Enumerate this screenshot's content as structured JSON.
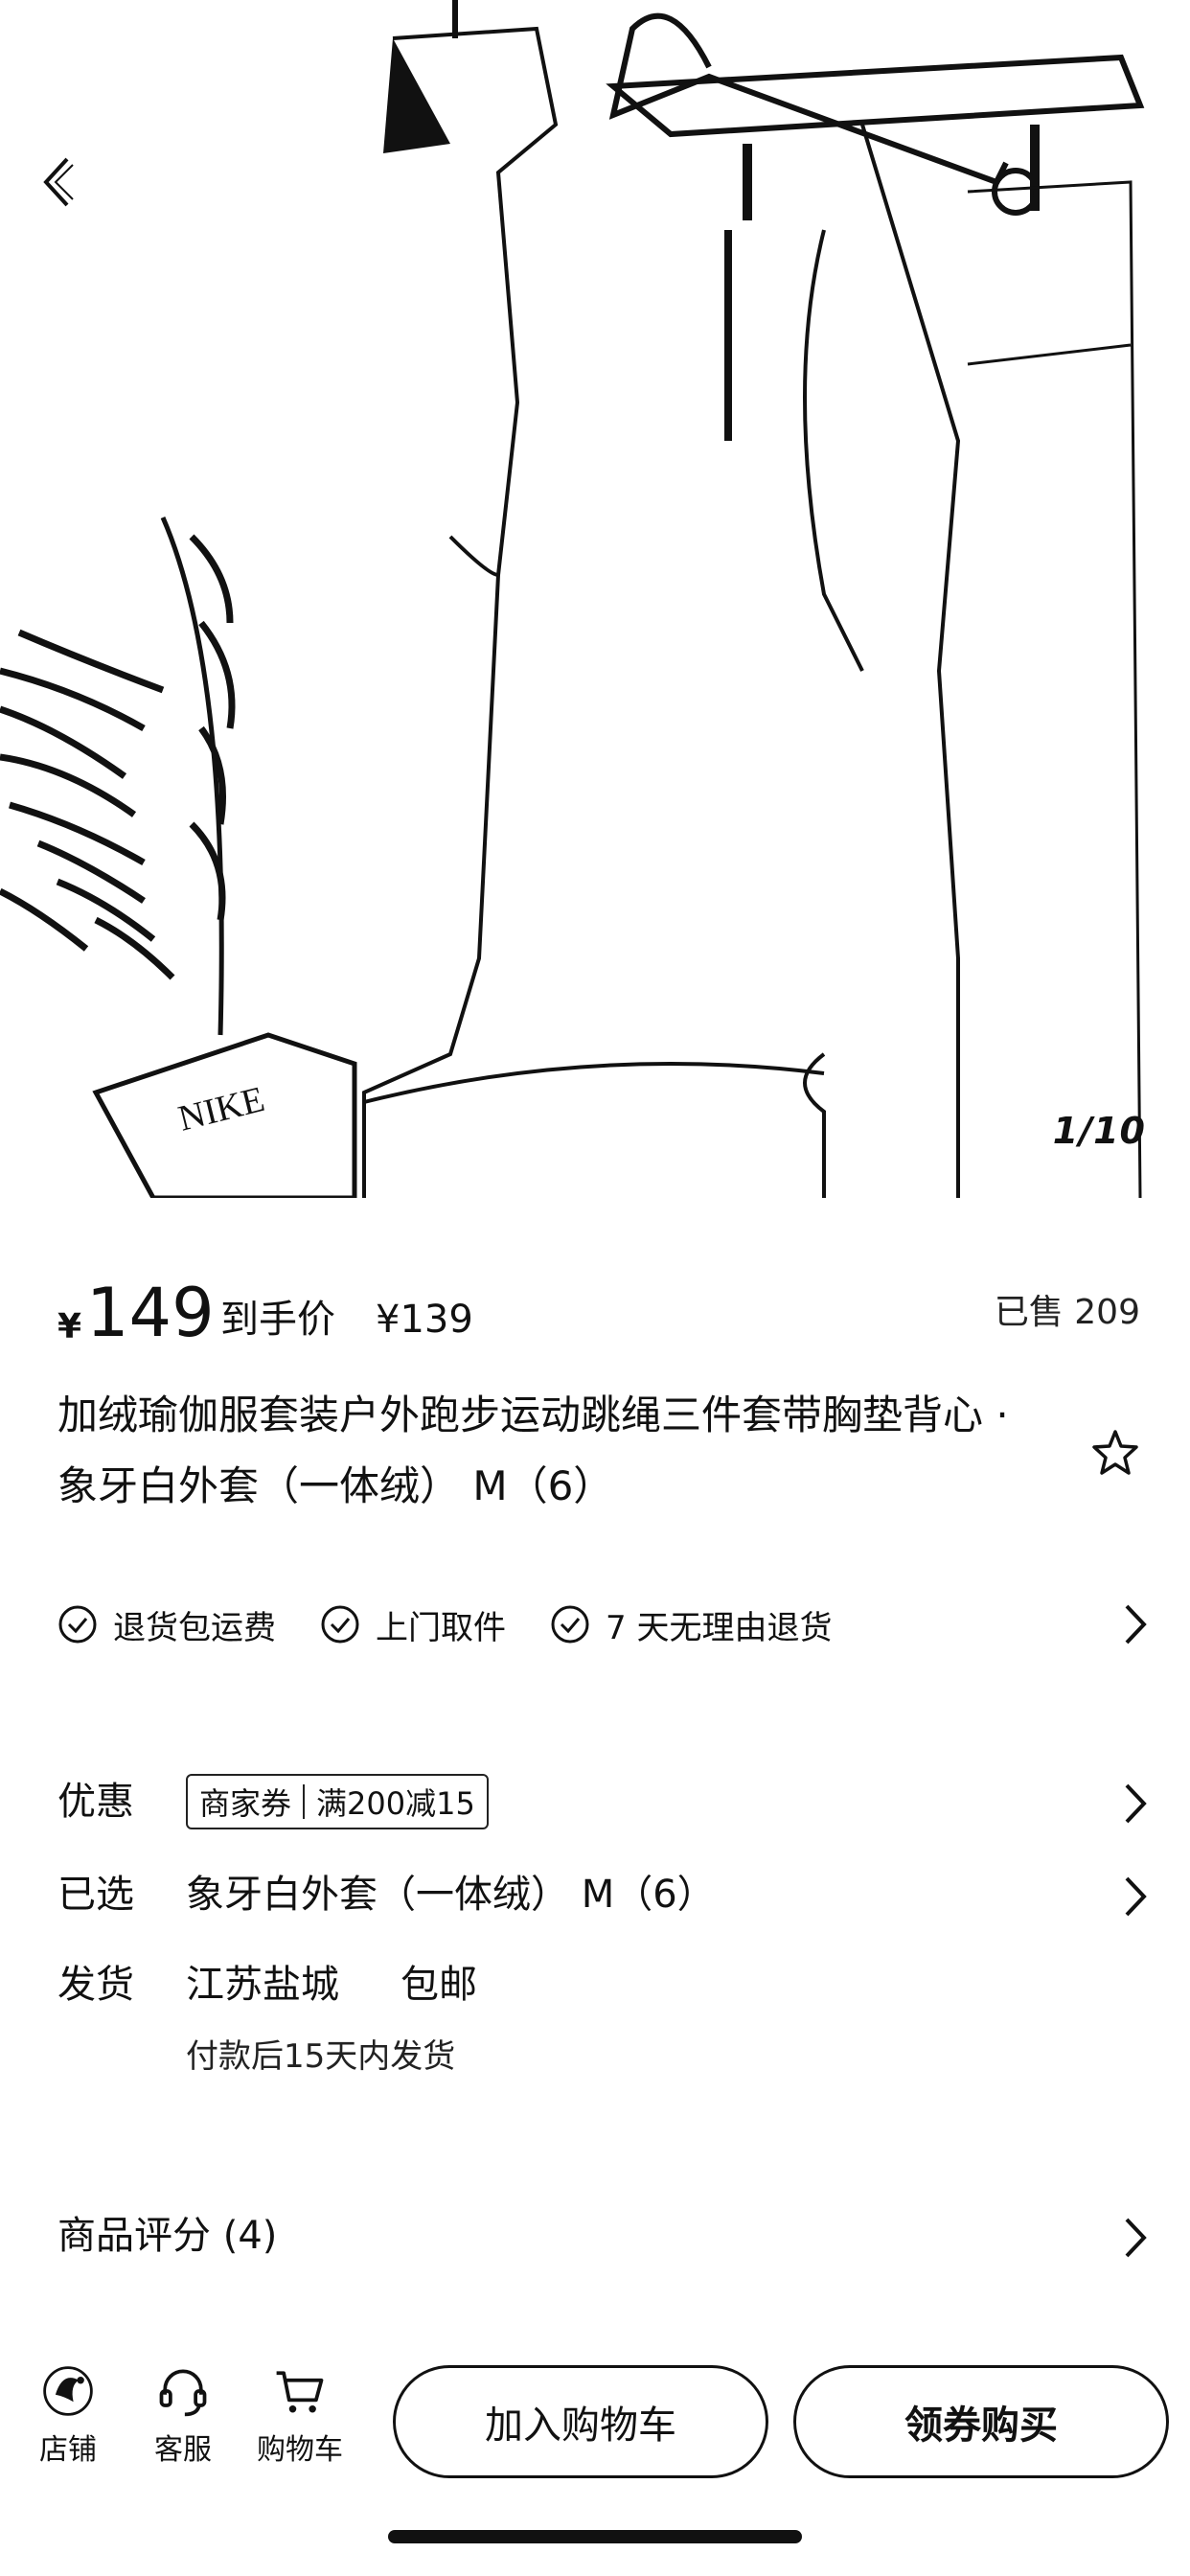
{
  "gallery": {
    "counter": "1/10",
    "logo_text": "NIKE"
  },
  "price": {
    "currency": "¥",
    "amount": "149",
    "net_label": "到手价",
    "net_price": "¥139",
    "sold": "已售 209"
  },
  "product": {
    "title": "加绒瑜伽服套装户外跑步运动跳绳三件套带胸垫背心 · 象牙白外套（一体绒） M（6）"
  },
  "services": [
    "退货包运费",
    "上门取件",
    "7 天无理由退货"
  ],
  "offers": {
    "label": "优惠",
    "coupon_tag": "商家券",
    "coupon_text": "满200减15"
  },
  "selected": {
    "label": "已选",
    "value": "象牙白外套（一体绒） M（6）"
  },
  "shipping": {
    "label": "发货",
    "from": "江苏盐城",
    "free": "包邮",
    "time": "付款后15天内发货"
  },
  "reviews": {
    "label": "商品评分 (4)"
  },
  "bottom_bar": {
    "shop": "店铺",
    "service": "客服",
    "cart": "购物车",
    "add_cart": "加入购物车",
    "buy": "领券购买"
  }
}
